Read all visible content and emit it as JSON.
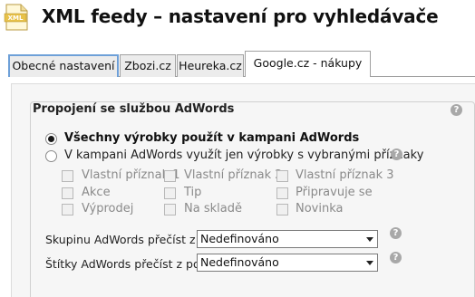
{
  "header": {
    "icon_text": "XML",
    "title": "XML feedy – nastavení pro vyhledávače"
  },
  "tabs": [
    {
      "label": "Obecné nastavení"
    },
    {
      "label": "Zbozi.cz"
    },
    {
      "label": "Heureka.cz"
    },
    {
      "label": "Google.cz - nákupy"
    }
  ],
  "adwords": {
    "title": "Propojení se službou AdWords",
    "radio_all": "Všechny výrobky použít v kampani AdWords",
    "radio_flags": "V kampani AdWords využít jen výrobky s vybranými příznaky",
    "checkboxes": [
      {
        "label": "Vlastní příznak   1"
      },
      {
        "label": "Vlastní příznak   2"
      },
      {
        "label": "Vlastní příznak   3"
      },
      {
        "label": "Akce"
      },
      {
        "label": "Tip"
      },
      {
        "label": "Připravuje se"
      },
      {
        "label": "Výprodej"
      },
      {
        "label": "Na skladě"
      },
      {
        "label": "Novinka"
      }
    ],
    "group_label": "Skupinu AdWords přečíst z",
    "group_value": "Nedefinováno",
    "labels_label": "Štítky AdWords přečíst z po",
    "labels_value": "Nedefinováno"
  },
  "icons": {
    "help": "help-icon",
    "file": "xml-file-icon"
  },
  "colors": {
    "active_tab_border": "#6ea0d8",
    "panel_bg": "#f6f6f6",
    "disabled_text": "#8a8a8a"
  }
}
